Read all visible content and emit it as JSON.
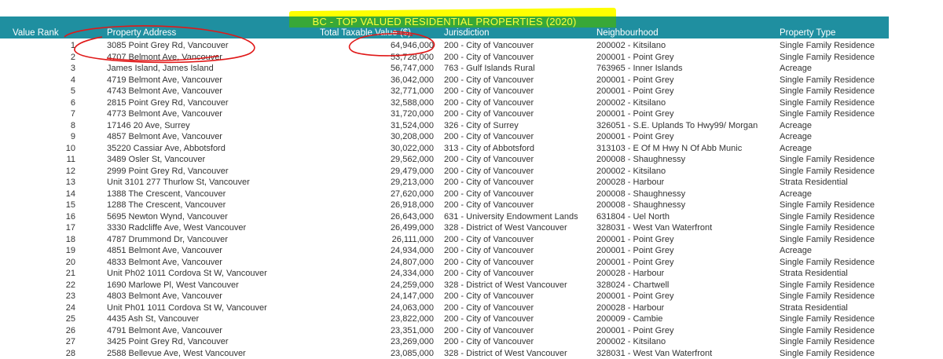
{
  "title": "BC - TOP VALUED RESIDENTIAL PROPERTIES (2020)",
  "columns": {
    "rank": "Value Rank",
    "address": "Property Address",
    "value": "Total Taxable Value ($)",
    "jurisdiction": "Jurisdiction",
    "neighbourhood": "Neighbourhood",
    "type": "Property Type"
  },
  "rows": [
    {
      "rank": "1",
      "address": "3085 Point Grey Rd, Vancouver",
      "value": "64,946,000",
      "jurisdiction": "200 - City of Vancouver",
      "neighbourhood": "200002 - Kitsilano",
      "type": "Single Family Residence"
    },
    {
      "rank": "2",
      "address": "4707 Belmont Ave, Vancouver",
      "value": "53,728,000",
      "jurisdiction": "200 - City of Vancouver",
      "neighbourhood": "200001 - Point Grey",
      "type": "Single Family Residence"
    },
    {
      "rank": "3",
      "address": "James Island, James Island",
      "value": "56,747,000",
      "jurisdiction": "763 - Gulf Islands Rural",
      "neighbourhood": "763965 - Inner Islands",
      "type": "Acreage"
    },
    {
      "rank": "4",
      "address": "4719 Belmont Ave, Vancouver",
      "value": "36,042,000",
      "jurisdiction": "200 - City of Vancouver",
      "neighbourhood": "200001 - Point Grey",
      "type": "Single Family Residence"
    },
    {
      "rank": "5",
      "address": "4743 Belmont Ave, Vancouver",
      "value": "32,771,000",
      "jurisdiction": "200 - City of Vancouver",
      "neighbourhood": "200001 - Point Grey",
      "type": "Single Family Residence"
    },
    {
      "rank": "6",
      "address": "2815 Point Grey Rd, Vancouver",
      "value": "32,588,000",
      "jurisdiction": "200 - City of Vancouver",
      "neighbourhood": "200002 - Kitsilano",
      "type": "Single Family Residence"
    },
    {
      "rank": "7",
      "address": "4773 Belmont Ave, Vancouver",
      "value": "31,720,000",
      "jurisdiction": "200 - City of Vancouver",
      "neighbourhood": "200001 - Point Grey",
      "type": "Single Family Residence"
    },
    {
      "rank": "8",
      "address": "17146 20 Ave, Surrey",
      "value": "31,524,000",
      "jurisdiction": "326 - City of Surrey",
      "neighbourhood": "326051 - S.E. Uplands To Hwy99/ Morgan",
      "type": "Acreage"
    },
    {
      "rank": "9",
      "address": "4857 Belmont Ave, Vancouver",
      "value": "30,208,000",
      "jurisdiction": "200 - City of Vancouver",
      "neighbourhood": "200001 - Point Grey",
      "type": "Acreage"
    },
    {
      "rank": "10",
      "address": "35220 Cassiar Ave, Abbotsford",
      "value": "30,022,000",
      "jurisdiction": "313 - City of Abbotsford",
      "neighbourhood": "313103 - E Of M Hwy N Of Abb Munic",
      "type": "Acreage"
    },
    {
      "rank": "11",
      "address": "3489 Osler St, Vancouver",
      "value": "29,562,000",
      "jurisdiction": "200 - City of Vancouver",
      "neighbourhood": "200008 - Shaughnessy",
      "type": "Single Family Residence"
    },
    {
      "rank": "12",
      "address": "2999 Point Grey Rd, Vancouver",
      "value": "29,479,000",
      "jurisdiction": "200 - City of Vancouver",
      "neighbourhood": "200002 - Kitsilano",
      "type": "Single Family Residence"
    },
    {
      "rank": "13",
      "address": "Unit 3101 277 Thurlow St, Vancouver",
      "value": "29,213,000",
      "jurisdiction": "200 - City of Vancouver",
      "neighbourhood": "200028 - Harbour",
      "type": "Strata Residential"
    },
    {
      "rank": "14",
      "address": "1388 The Crescent, Vancouver",
      "value": "27,620,000",
      "jurisdiction": "200 - City of Vancouver",
      "neighbourhood": "200008 - Shaughnessy",
      "type": "Acreage"
    },
    {
      "rank": "15",
      "address": "1288 The Crescent, Vancouver",
      "value": "26,918,000",
      "jurisdiction": "200 - City of Vancouver",
      "neighbourhood": "200008 - Shaughnessy",
      "type": "Single Family Residence"
    },
    {
      "rank": "16",
      "address": "5695 Newton Wynd, Vancouver",
      "value": "26,643,000",
      "jurisdiction": "631 - University Endowment Lands",
      "neighbourhood": "631804 - Uel North",
      "type": "Single Family Residence"
    },
    {
      "rank": "17",
      "address": "3330 Radcliffe Ave, West Vancouver",
      "value": "26,499,000",
      "jurisdiction": "328 - District of West Vancouver",
      "neighbourhood": "328031 - West Van Waterfront",
      "type": "Single Family Residence"
    },
    {
      "rank": "18",
      "address": "4787 Drummond Dr, Vancouver",
      "value": "26,111,000",
      "jurisdiction": "200 - City of Vancouver",
      "neighbourhood": "200001 - Point Grey",
      "type": "Single Family Residence"
    },
    {
      "rank": "19",
      "address": "4851 Belmont Ave, Vancouver",
      "value": "24,934,000",
      "jurisdiction": "200 - City of Vancouver",
      "neighbourhood": "200001 - Point Grey",
      "type": "Acreage"
    },
    {
      "rank": "20",
      "address": "4833 Belmont Ave, Vancouver",
      "value": "24,807,000",
      "jurisdiction": "200 - City of Vancouver",
      "neighbourhood": "200001 - Point Grey",
      "type": "Single Family Residence"
    },
    {
      "rank": "21",
      "address": "Unit Ph02 1011 Cordova St W, Vancouver",
      "value": "24,334,000",
      "jurisdiction": "200 - City of Vancouver",
      "neighbourhood": "200028 - Harbour",
      "type": "Strata Residential"
    },
    {
      "rank": "22",
      "address": "1690 Marlowe Pl, West Vancouver",
      "value": "24,259,000",
      "jurisdiction": "328 - District of West Vancouver",
      "neighbourhood": "328024 - Chartwell",
      "type": "Single Family Residence"
    },
    {
      "rank": "23",
      "address": "4803 Belmont Ave, Vancouver",
      "value": "24,147,000",
      "jurisdiction": "200 - City of Vancouver",
      "neighbourhood": "200001 - Point Grey",
      "type": "Single Family Residence"
    },
    {
      "rank": "24",
      "address": "Unit Ph01 1011 Cordova St W, Vancouver",
      "value": "24,063,000",
      "jurisdiction": "200 - City of Vancouver",
      "neighbourhood": "200028 - Harbour",
      "type": "Strata Residential"
    },
    {
      "rank": "25",
      "address": "4435 Ash St, Vancouver",
      "value": "23,822,000",
      "jurisdiction": "200 - City of Vancouver",
      "neighbourhood": "200009 - Cambie",
      "type": "Single Family Residence"
    },
    {
      "rank": "26",
      "address": "4791 Belmont Ave, Vancouver",
      "value": "23,351,000",
      "jurisdiction": "200 - City of Vancouver",
      "neighbourhood": "200001 - Point Grey",
      "type": "Single Family Residence"
    },
    {
      "rank": "27",
      "address": "3425 Point Grey Rd, Vancouver",
      "value": "23,269,000",
      "jurisdiction": "200 - City of Vancouver",
      "neighbourhood": "200002 - Kitsilano",
      "type": "Single Family Residence"
    },
    {
      "rank": "28",
      "address": "2588 Bellevue Ave, West Vancouver",
      "value": "23,085,000",
      "jurisdiction": "328 - District of West Vancouver",
      "neighbourhood": "328031 - West Van Waterfront",
      "type": "Single Family Residence"
    }
  ],
  "colors": {
    "header_bg": "#1f8fa0",
    "title_text": "#ffff3a",
    "highlight": "#ffff00",
    "annotation": "#e01818"
  }
}
